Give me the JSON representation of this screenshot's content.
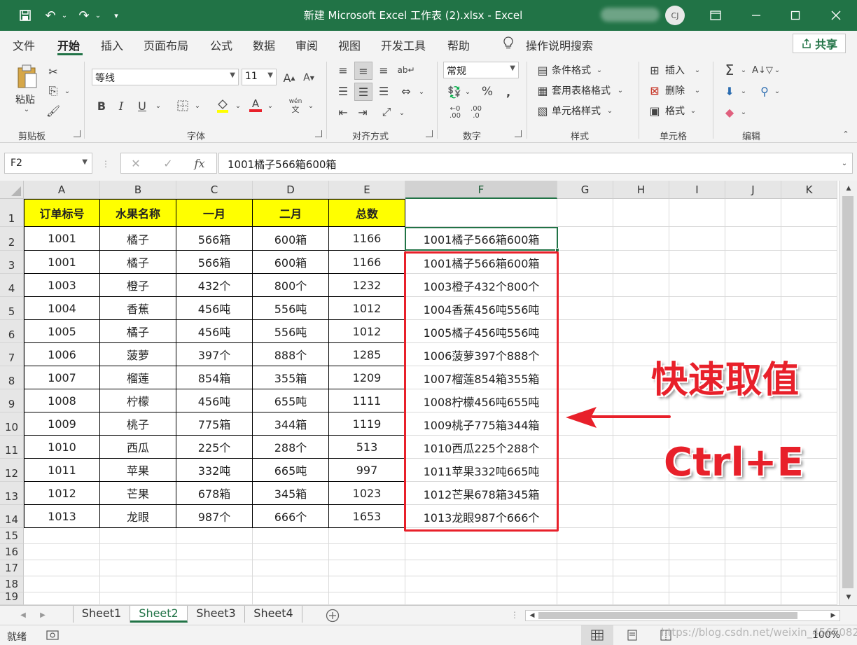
{
  "title": "新建 Microsoft Excel 工作表 (2).xlsx  -  Excel",
  "user_avatar": "CJ",
  "menu_tabs": [
    "文件",
    "开始",
    "插入",
    "页面布局",
    "公式",
    "数据",
    "审阅",
    "视图",
    "开发工具",
    "帮助",
    "操作说明搜索"
  ],
  "active_tab": "开始",
  "share_label": "共享",
  "ribbon": {
    "paste_label": "粘贴",
    "font_name": "等线",
    "font_size": "11",
    "number_format": "常规",
    "cond_format": "条件格式",
    "table_format": "套用表格格式",
    "cell_style": "单元格样式",
    "insert": "插入",
    "delete": "删除",
    "format": "格式",
    "groups": [
      "剪贴板",
      "字体",
      "对齐方式",
      "数字",
      "样式",
      "单元格",
      "编辑"
    ],
    "bold": "B",
    "italic": "I",
    "underline": "U",
    "font_color": "A",
    "percent": "%",
    "comma": ",",
    "inc_decimal": ".00",
    "dec_decimal": ".0"
  },
  "name_box": "F2",
  "formula": "1001橘子566箱600箱",
  "columns": [
    "A",
    "B",
    "C",
    "D",
    "E",
    "F",
    "G",
    "H",
    "I",
    "J",
    "K"
  ],
  "rows": [
    "1",
    "2",
    "3",
    "4",
    "5",
    "6",
    "7",
    "8",
    "9",
    "10",
    "11",
    "12",
    "13",
    "14",
    "15",
    "16",
    "17",
    "18",
    "19"
  ],
  "table": {
    "headers": [
      "订单标号",
      "水果名称",
      "一月",
      "二月",
      "总数"
    ],
    "rows": [
      [
        "1001",
        "橘子",
        "566箱",
        "600箱",
        "1166",
        "1001橘子566箱600箱"
      ],
      [
        "1001",
        "橘子",
        "566箱",
        "600箱",
        "1166",
        "1001橘子566箱600箱"
      ],
      [
        "1003",
        "橙子",
        "432个",
        "800个",
        "1232",
        "1003橙子432个800个"
      ],
      [
        "1004",
        "香蕉",
        "456吨",
        "556吨",
        "1012",
        "1004香蕉456吨556吨"
      ],
      [
        "1005",
        "橘子",
        "456吨",
        "556吨",
        "1012",
        "1005橘子456吨556吨"
      ],
      [
        "1006",
        "菠萝",
        "397个",
        "888个",
        "1285",
        "1006菠萝397个888个"
      ],
      [
        "1007",
        "榴莲",
        "854箱",
        "355箱",
        "1209",
        "1007榴莲854箱355箱"
      ],
      [
        "1008",
        "柠檬",
        "456吨",
        "655吨",
        "1111",
        "1008柠檬456吨655吨"
      ],
      [
        "1009",
        "桃子",
        "775箱",
        "344箱",
        "1119",
        "1009桃子775箱344箱"
      ],
      [
        "1010",
        "西瓜",
        "225个",
        "288个",
        "513",
        "1010西瓜225个288个"
      ],
      [
        "1011",
        "苹果",
        "332吨",
        "665吨",
        "997",
        "1011苹果332吨665吨"
      ],
      [
        "1012",
        "芒果",
        "678箱",
        "345箱",
        "1023",
        "1012芒果678箱345箱"
      ],
      [
        "1013",
        "龙眼",
        "987个",
        "666个",
        "1653",
        "1013龙眼987个666个"
      ]
    ]
  },
  "annotation_title": "快速取值",
  "annotation_shortcut": "Ctrl+E",
  "sheets": [
    "Sheet1",
    "Sheet2",
    "Sheet3",
    "Sheet4"
  ],
  "active_sheet": "Sheet2",
  "status": "就绪",
  "zoom": "100%",
  "watermark": "https://blog.csdn.net/weixin_45650826",
  "colors": {
    "excel_green": "#217346",
    "header_yellow": "#ffff00",
    "annotation_red": "#e8202a"
  }
}
